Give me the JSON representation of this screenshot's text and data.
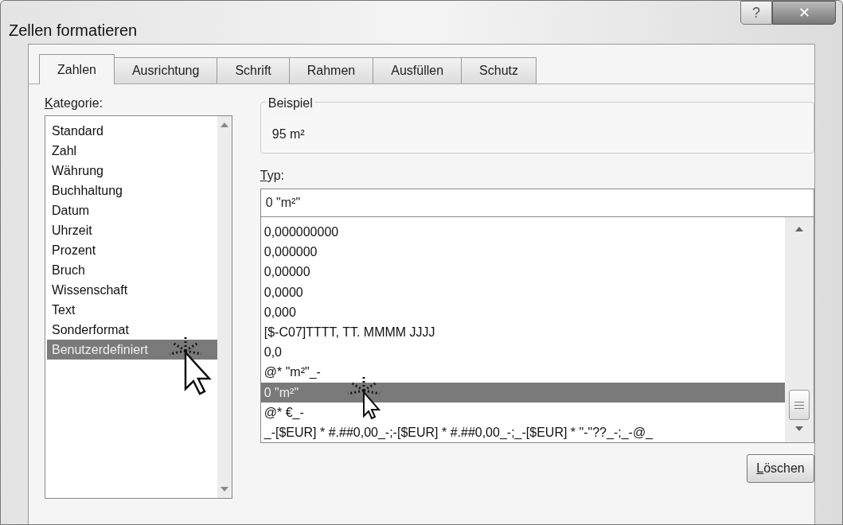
{
  "window": {
    "title": "Zellen formatieren",
    "buttons": [
      {
        "kind": "help",
        "label": "?"
      },
      {
        "kind": "close",
        "label": "✕"
      }
    ]
  },
  "tabs": [
    {
      "label": "Zahlen",
      "selected": true
    },
    {
      "label": "Ausrichtung",
      "selected": false
    },
    {
      "label": "Schrift",
      "selected": false
    },
    {
      "label": "Rahmen",
      "selected": false
    },
    {
      "label": "Ausfüllen",
      "selected": false
    },
    {
      "label": "Schutz",
      "selected": false
    }
  ],
  "category": {
    "label": "Kategorie:",
    "first_letter_underlined": true,
    "items": [
      {
        "label": "Standard",
        "selected": false
      },
      {
        "label": "Zahl",
        "selected": false
      },
      {
        "label": "Währung",
        "selected": false
      },
      {
        "label": "Buchhaltung",
        "selected": false
      },
      {
        "label": "Datum",
        "selected": false
      },
      {
        "label": "Uhrzeit",
        "selected": false
      },
      {
        "label": "Prozent",
        "selected": false
      },
      {
        "label": "Bruch",
        "selected": false
      },
      {
        "label": "Wissenschaft",
        "selected": false
      },
      {
        "label": "Text",
        "selected": false
      },
      {
        "label": "Sonderformat",
        "selected": false
      },
      {
        "label": "Benutzerdefiniert",
        "selected": true
      }
    ]
  },
  "sample": {
    "title": "Beispiel",
    "value": "95 m²"
  },
  "type": {
    "label": "Typ:",
    "first_letter_underlined": true,
    "value": "0 \"m²\"",
    "items": [
      {
        "label": "0,000000000",
        "selected": false
      },
      {
        "label": "0,000000",
        "selected": false
      },
      {
        "label": "0,00000",
        "selected": false
      },
      {
        "label": "0,0000",
        "selected": false
      },
      {
        "label": "0,000",
        "selected": false
      },
      {
        "label": "[$-C07]TTTT, TT. MMMM JJJJ",
        "selected": false
      },
      {
        "label": "0,0",
        "selected": false
      },
      {
        "label": "@* \"m²\"_-",
        "selected": false
      },
      {
        "label": "0 \"m²\"",
        "selected": true
      },
      {
        "label": "@* €_-",
        "selected": false
      },
      {
        "label": "_-[$EUR] * #.##0,00_-;-[$EUR] * #.##0,00_-;_-[$EUR] * \"-\"??_-;_-@_",
        "selected": false
      }
    ]
  },
  "delete_button": {
    "label": "Löschen",
    "first_letter_underlined": true
  }
}
